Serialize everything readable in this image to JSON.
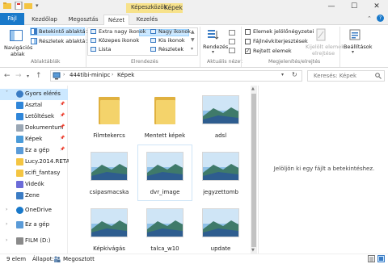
{
  "titlebar": {
    "context_tab": "Képeszközök",
    "title": "Képek",
    "minimize": "—",
    "maximize": "☐",
    "close": "✕"
  },
  "tabs": [
    "Fájl",
    "Kezdőlap",
    "Megosztás",
    "Nézet",
    "Kezelés"
  ],
  "ribbon": {
    "nav_pane": "Navigációs",
    "nav_pane_2": "ablak",
    "preview_pane": "Betekintő ablaktábla",
    "details_pane": "Részletek ablaktábla",
    "panes_group": "Ablaktáblák",
    "layout_items": [
      "Extra nagy ikonok",
      "Nagy ikonok",
      "Közepes ikonok",
      "Kis ikonok",
      "Lista",
      "Részletek"
    ],
    "layout_group": "Elrendezés",
    "sort_label": "Rendezés",
    "current_view_group": "Aktuális nézet",
    "checkbox_1": "Elemek jelölőnégyzetei",
    "checkbox_2": "Fájlnévkiterjesztések",
    "checkbox_3": "Rejtett elemek",
    "hide_selected": "Kijelölt elemek",
    "hide_selected_2": "elrejtése",
    "show_hide_group": "Megjelenítés/elrejtés",
    "options": "Beállítások"
  },
  "address": {
    "path": [
      "444tibi-minipc",
      "Képek"
    ],
    "search_placeholder": "Keresés: Képek"
  },
  "sidebar": {
    "items": [
      {
        "label": "Gyors elérés",
        "icon": "star-icon",
        "pinned": false
      },
      {
        "label": "Asztal",
        "icon": "desktop-icon",
        "pinned": true
      },
      {
        "label": "Letöltések",
        "icon": "download-icon",
        "pinned": true
      },
      {
        "label": "Dokumentum",
        "icon": "document-icon",
        "pinned": true
      },
      {
        "label": "Képek",
        "icon": "pictures-icon",
        "pinned": true
      },
      {
        "label": "Ez a gép",
        "icon": "computer-icon",
        "pinned": true
      },
      {
        "label": "Lucy.2014.RETAIL",
        "icon": "folder-icon",
        "pinned": false
      },
      {
        "label": "scifi_fantasy",
        "icon": "folder-icon",
        "pinned": false
      },
      {
        "label": "Videók",
        "icon": "video-icon",
        "pinned": false
      },
      {
        "label": "Zene",
        "icon": "music-icon",
        "pinned": false
      },
      {
        "label": "OneDrive",
        "icon": "cloud-icon",
        "pinned": false
      },
      {
        "label": "Ez a gép",
        "icon": "computer-icon",
        "pinned": false
      },
      {
        "label": "FILM (D:)",
        "icon": "drive-icon",
        "pinned": false
      }
    ]
  },
  "files": [
    {
      "name": "Filmtekercs",
      "type": "folder"
    },
    {
      "name": "Mentett képek",
      "type": "folder"
    },
    {
      "name": "adsl",
      "type": "image"
    },
    {
      "name": "csipasmacska",
      "type": "image"
    },
    {
      "name": "dvr_image",
      "type": "image"
    },
    {
      "name": "jegyzettomb",
      "type": "image"
    },
    {
      "name": "Képkivágás",
      "type": "image"
    },
    {
      "name": "talca_w10",
      "type": "image"
    },
    {
      "name": "update",
      "type": "image"
    }
  ],
  "preview_message": "Jelöljön ki egy fájlt a betekintéshez.",
  "status": {
    "count": "9 elem",
    "state_label": "Állapot:",
    "state_value": "Megosztott"
  },
  "colors": {
    "accent": "#1979ca",
    "selection": "#cce8ff",
    "folder": "#f4d36b"
  }
}
